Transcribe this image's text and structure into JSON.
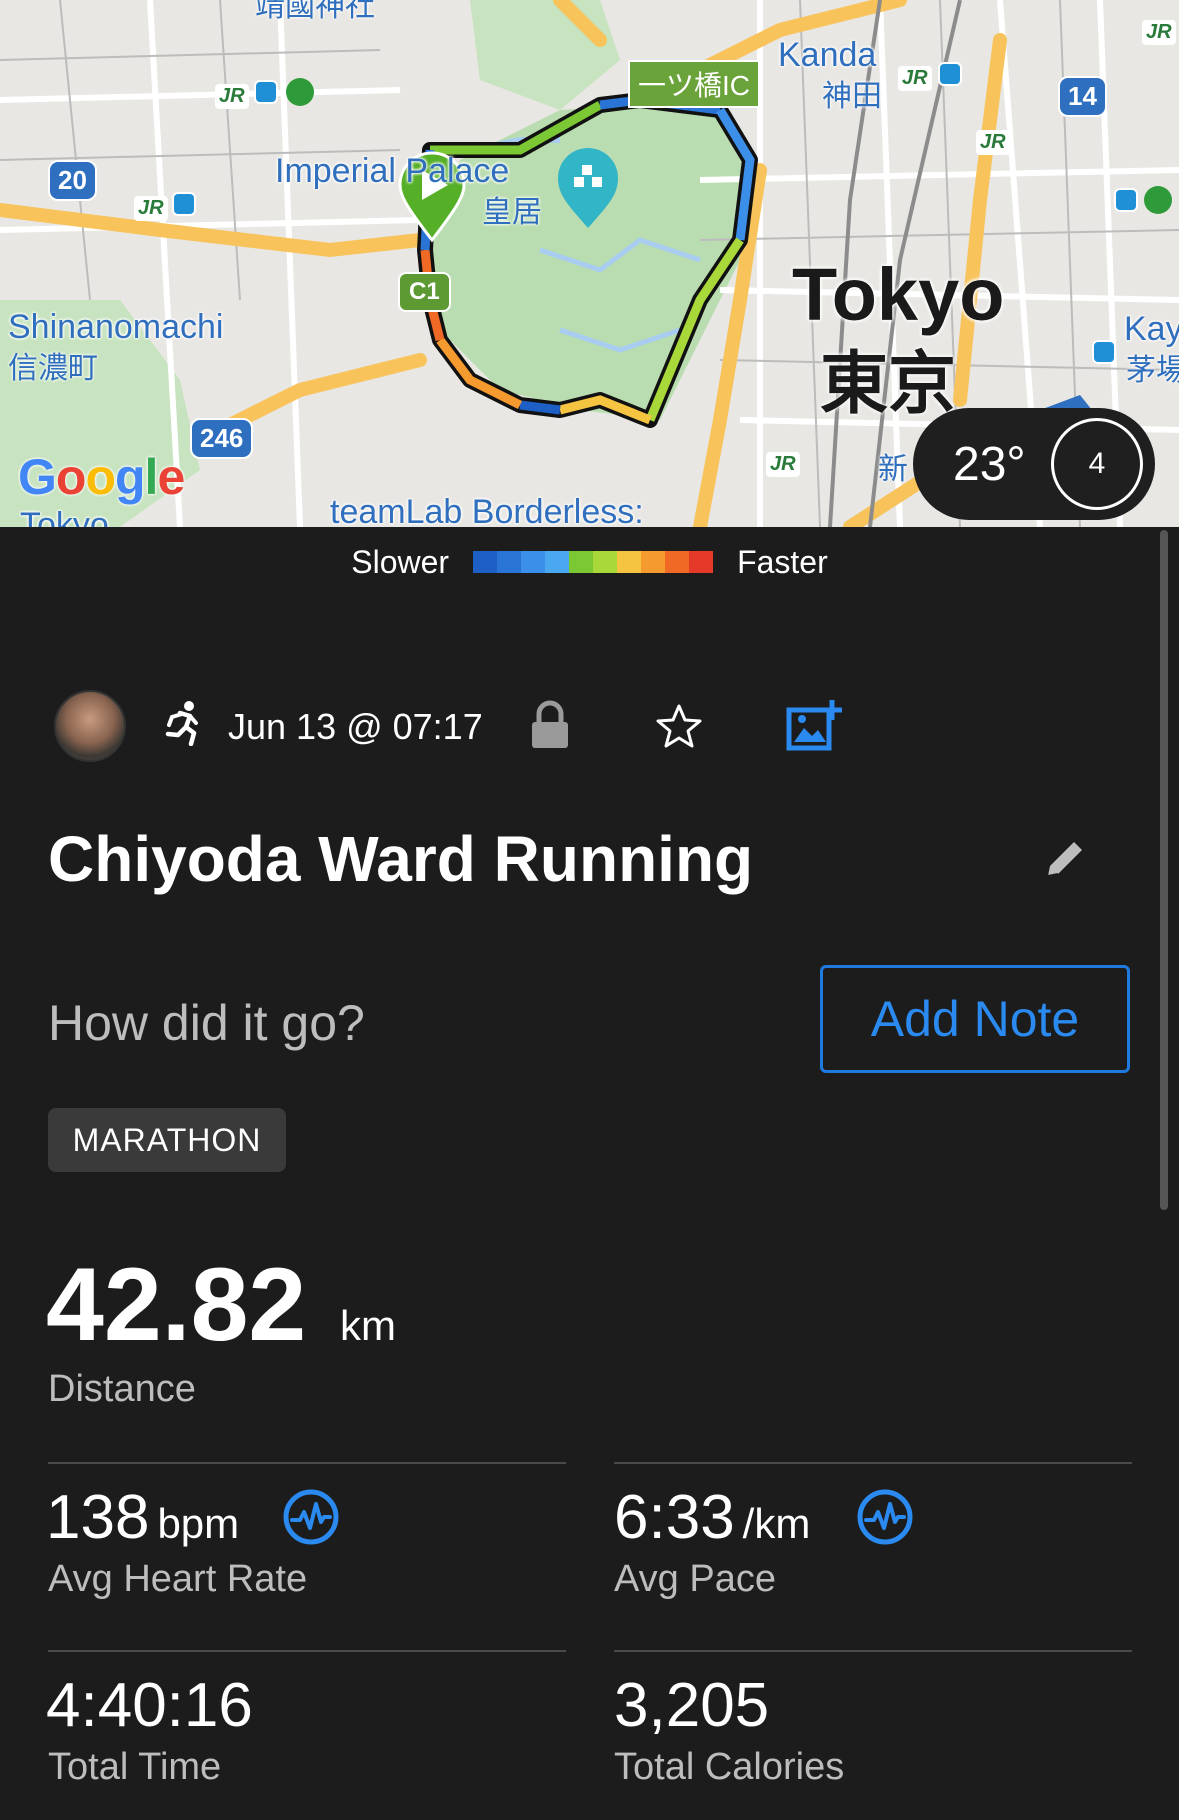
{
  "map": {
    "labels": {
      "top_partial": "靖國神社",
      "kanda_en": "Kanda",
      "kanda_jp": "神田",
      "hitotsubashi_ic": "一ツ橋IC",
      "imperial_palace_en": "Imperial Palace",
      "imperial_palace_jp": "皇居",
      "shinanomachi_en": "Shinanomachi",
      "shinanomachi_jp": "信濃町",
      "tokyo_en": "Tokyo",
      "tokyo_jp": "東京",
      "kay_en": "Kay",
      "kayaba_jp": "茅場",
      "teamlab": "teamLab Borderless:",
      "shin_partial": "新",
      "tokyo_partial": "Tokyo"
    },
    "shields": {
      "r20": "20",
      "r246": "246",
      "r14": "14",
      "c1": "C1"
    },
    "jr_label": "JR",
    "google_logo": "Google",
    "weather": {
      "temp": "23°",
      "wind": "4"
    }
  },
  "legend": {
    "slower": "Slower",
    "faster": "Faster",
    "colors": [
      "#1d5fc4",
      "#2a74d6",
      "#3b8fe8",
      "#4aa8f0",
      "#7cc834",
      "#a9d83a",
      "#f5c542",
      "#f59a2f",
      "#f06a26",
      "#e53a2a"
    ]
  },
  "activity": {
    "date": "Jun 13 @ 07:17",
    "title": "Chiyoda Ward Running",
    "note_prompt": "How did it go?",
    "add_note_label": "Add Note",
    "tag": "MARATHON"
  },
  "distance": {
    "value": "42.82",
    "unit": "km",
    "label": "Distance"
  },
  "stats": {
    "heart_rate": {
      "value": "138",
      "unit": "bpm",
      "label": "Avg Heart Rate"
    },
    "pace": {
      "value": "6:33",
      "unit": "/km",
      "label": "Avg Pace"
    },
    "total_time": {
      "value": "4:40:16",
      "label": "Total Time"
    },
    "calories": {
      "value": "3,205",
      "label": "Total Calories"
    }
  },
  "colors": {
    "accent": "#1f7ae0",
    "background": "#1c1c1c",
    "muted_text": "#bdbdbd"
  }
}
